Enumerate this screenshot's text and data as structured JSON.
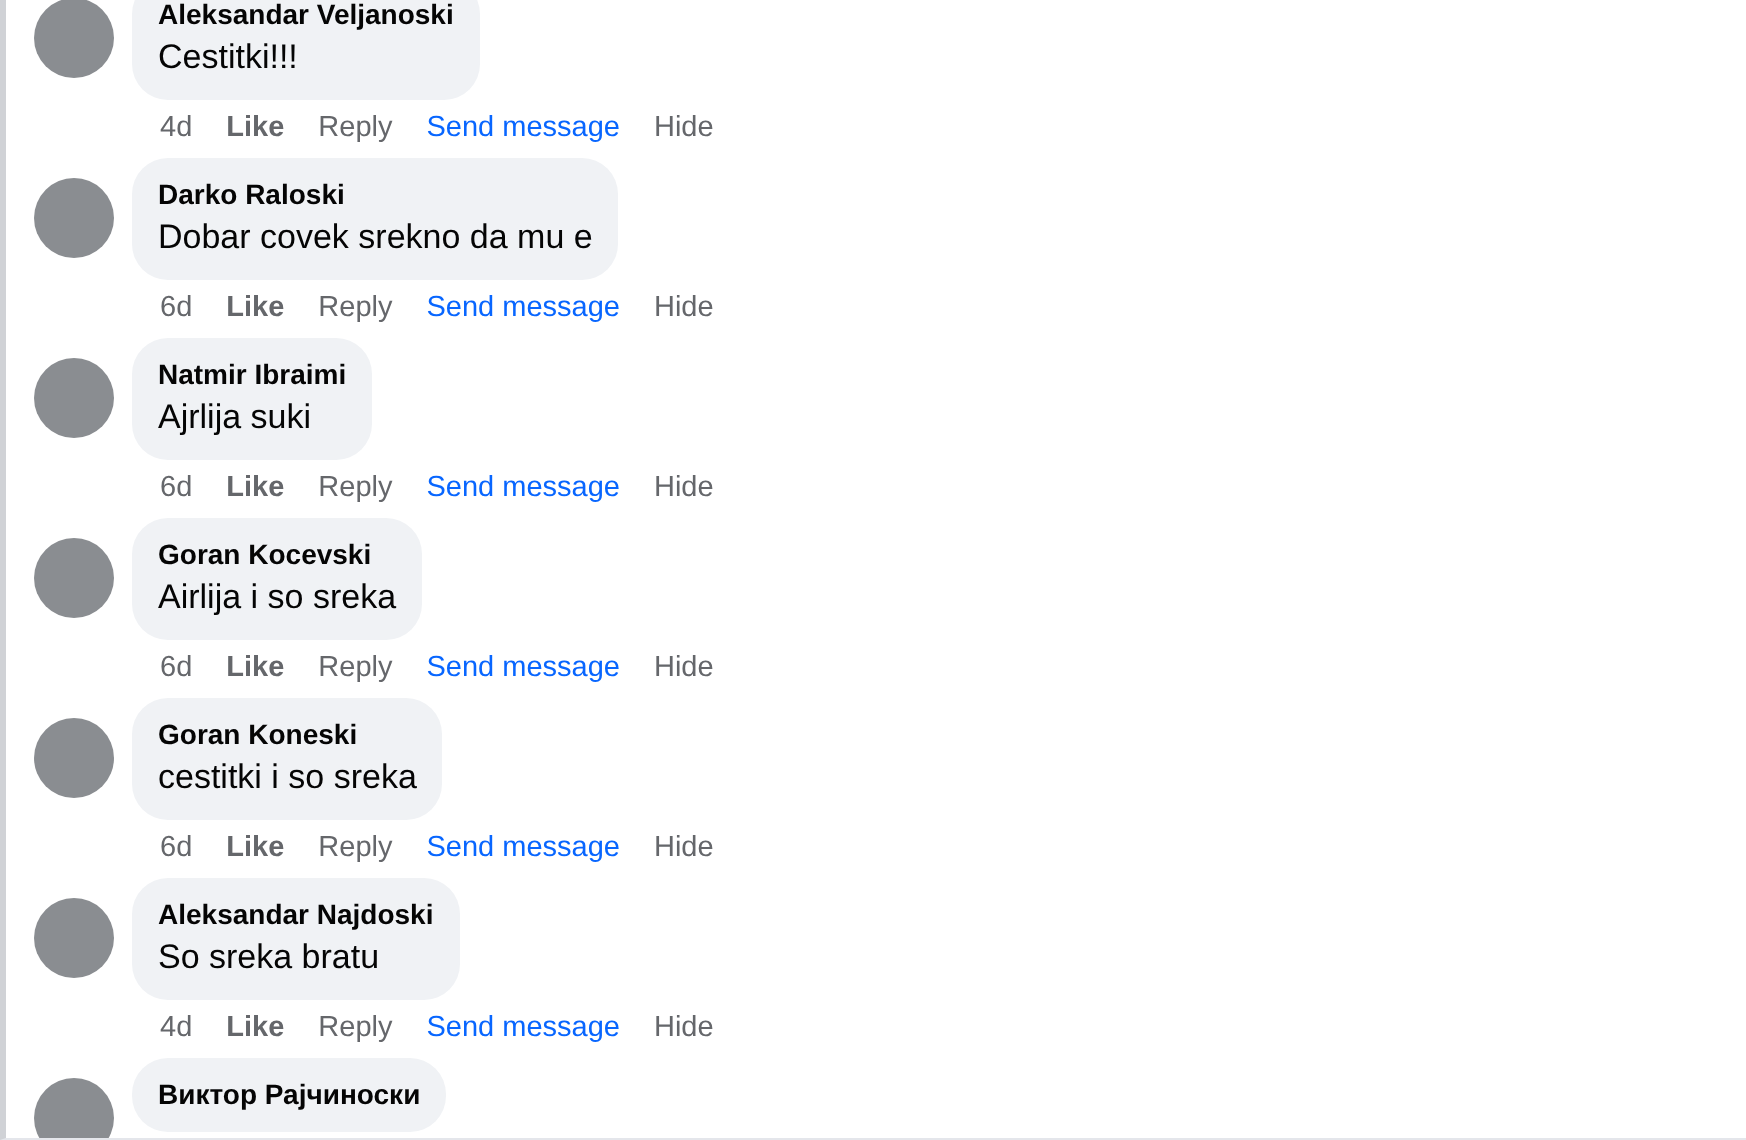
{
  "comments": [
    {
      "author": "Aleksandar Veljanoski",
      "text": "Cestitki!!!",
      "time": "4d",
      "actions": [
        {
          "label": "Like",
          "kind": "like"
        },
        {
          "label": "Reply",
          "kind": "reply"
        },
        {
          "label": "Send message",
          "kind": "link"
        },
        {
          "label": "Hide",
          "kind": "hide"
        }
      ]
    },
    {
      "author": "Darko Raloski",
      "text": "Dobar covek srekno da mu e",
      "time": "6d",
      "actions": [
        {
          "label": "Like",
          "kind": "like"
        },
        {
          "label": "Reply",
          "kind": "reply"
        },
        {
          "label": "Send message",
          "kind": "link"
        },
        {
          "label": "Hide",
          "kind": "hide"
        }
      ]
    },
    {
      "author": "Natmir Ibraimi",
      "text": "Ajrlija suki",
      "time": "6d",
      "actions": [
        {
          "label": "Like",
          "kind": "like"
        },
        {
          "label": "Reply",
          "kind": "reply"
        },
        {
          "label": "Send message",
          "kind": "link"
        },
        {
          "label": "Hide",
          "kind": "hide"
        }
      ]
    },
    {
      "author": "Goran Kocevski",
      "text": "Airlija i so sreka",
      "time": "6d",
      "actions": [
        {
          "label": "Like",
          "kind": "like"
        },
        {
          "label": "Reply",
          "kind": "reply"
        },
        {
          "label": "Send message",
          "kind": "link"
        },
        {
          "label": "Hide",
          "kind": "hide"
        }
      ]
    },
    {
      "author": "Goran Koneski",
      "text": "cestitki i so sreka",
      "time": "6d",
      "actions": [
        {
          "label": "Like",
          "kind": "like"
        },
        {
          "label": "Reply",
          "kind": "reply"
        },
        {
          "label": "Send message",
          "kind": "link"
        },
        {
          "label": "Hide",
          "kind": "hide"
        }
      ]
    },
    {
      "author": "Aleksandar Najdoski",
      "text": "So sreka bratu",
      "time": "4d",
      "actions": [
        {
          "label": "Like",
          "kind": "like"
        },
        {
          "label": "Reply",
          "kind": "reply"
        },
        {
          "label": "Send message",
          "kind": "link"
        },
        {
          "label": "Hide",
          "kind": "hide"
        }
      ]
    },
    {
      "author": "Виктор Рајчиноски"
    }
  ]
}
